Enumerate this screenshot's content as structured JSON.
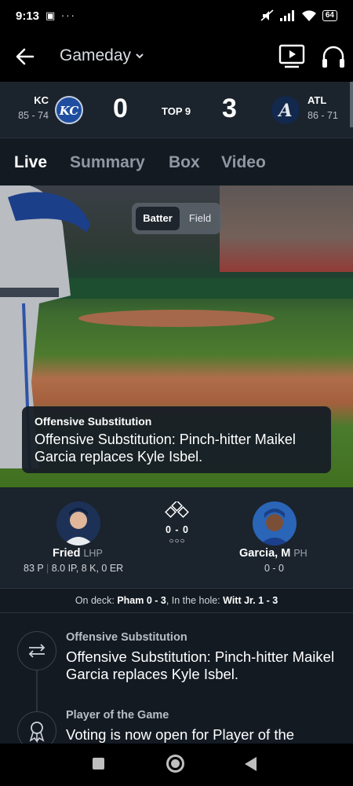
{
  "status_bar": {
    "time": "9:13",
    "left_icons": "▣ ···",
    "battery": "64",
    "icons": [
      "silent-icon",
      "signal-icon",
      "wifi-icon",
      "battery-icon"
    ]
  },
  "header": {
    "title": "Gameday",
    "icons": [
      "back-arrow-icon",
      "chevron-down-icon",
      "tv-play-icon",
      "headphones-icon"
    ]
  },
  "scoreboard": {
    "away": {
      "abbr": "KC",
      "record": "85 - 74",
      "score": "0",
      "logo_letters": "KC",
      "logo_color": "#1f4ea0"
    },
    "home": {
      "abbr": "ATL",
      "record": "86 - 71",
      "score": "3",
      "logo_letters": "A",
      "logo_color": "#12284c"
    },
    "inning": "TOP 9"
  },
  "tabs": [
    {
      "label": "Live",
      "active": true
    },
    {
      "label": "Summary",
      "active": false
    },
    {
      "label": "Box",
      "active": false
    },
    {
      "label": "Video",
      "active": false
    }
  ],
  "video": {
    "toggle": {
      "batter": "Batter",
      "field": "Field",
      "selected": "Batter"
    },
    "overlay": {
      "title": "Offensive Substitution",
      "description": "Offensive Substitution: Pinch-hitter Maikel Garcia replaces Kyle Isbel."
    }
  },
  "matchup": {
    "pitcher": {
      "name": "Fried",
      "pos": "LHP",
      "stats_pitches": "83 P",
      "stats_line": "8.0 IP, 8 K, 0 ER"
    },
    "batter": {
      "name": "Garcia, M",
      "pos": "PH",
      "stats": "0 - 0"
    },
    "count": "0 - 0",
    "outs": "○○○"
  },
  "on_deck": {
    "on_deck_label": "On deck: ",
    "on_deck_value": "Pham 0 - 3",
    "in_hole_label": ", In the hole: ",
    "in_hole_value": "Witt Jr. 1 - 3"
  },
  "feed": [
    {
      "title": "Offensive Substitution",
      "description": "Offensive Substitution: Pinch-hitter Maikel Garcia replaces Kyle Isbel.",
      "icon": "swap-arrows-icon"
    },
    {
      "title": "Player of the Game",
      "description": "Voting is now open for Player of the",
      "icon": "award-ribbon-icon"
    }
  ],
  "nav": {
    "icons": [
      "recents-square-icon",
      "home-circle-icon",
      "back-triangle-icon"
    ]
  }
}
